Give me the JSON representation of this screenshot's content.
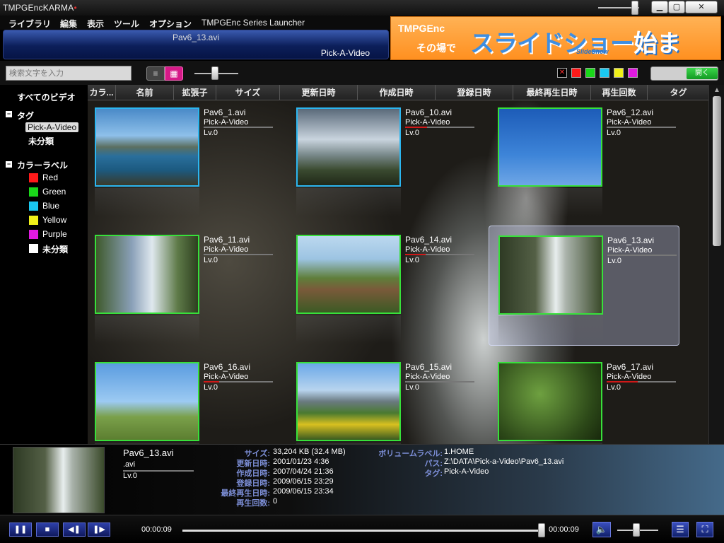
{
  "app": {
    "logo_main": "TMPGEnc",
    "logo_karma": "KARMA"
  },
  "window": {
    "min": "▁",
    "max": "▢",
    "close": "✕"
  },
  "menu": [
    {
      "label": "ライブラリ"
    },
    {
      "label": "編集"
    },
    {
      "label": "表示"
    },
    {
      "label": "ツール"
    },
    {
      "label": "オプション"
    },
    {
      "label": "TMPGEnc Series Launcher"
    }
  ],
  "now_playing": {
    "file": "Pav6_13.avi",
    "tag": "Pick-A-Video"
  },
  "ad": {
    "brand": "TMPGEnc",
    "sub": "その場で",
    "title_a": "スライドショー",
    "title_b": "始まる。",
    "slideshow": "SlideShow"
  },
  "toolbar": {
    "search_placeholder": "検索文字を入力",
    "view_list_icon": "≡",
    "view_grid_icon": "▦",
    "open_label": "開く",
    "color_filters": [
      {
        "name": "none",
        "color": "#000000",
        "mark": "✕"
      },
      {
        "name": "red",
        "color": "#ff1a1a",
        "mark": ""
      },
      {
        "name": "green",
        "color": "#1ad81a",
        "mark": ""
      },
      {
        "name": "blue",
        "color": "#1ac8f0",
        "mark": ""
      },
      {
        "name": "yellow",
        "color": "#f0f01a",
        "mark": ""
      },
      {
        "name": "purple",
        "color": "#e01ae0",
        "mark": ""
      }
    ]
  },
  "sidebar": {
    "all_videos": "すべてのビデオ",
    "tag_header": "タグ",
    "tags": [
      {
        "label": "Pick-A-Video"
      },
      {
        "label": "未分類"
      }
    ],
    "color_header": "カラーラベル",
    "colors": [
      {
        "label": "Red",
        "color": "#ff1a1a"
      },
      {
        "label": "Green",
        "color": "#1ad81a"
      },
      {
        "label": "Blue",
        "color": "#1ac8f0"
      },
      {
        "label": "Yellow",
        "color": "#f0f01a"
      },
      {
        "label": "Purple",
        "color": "#e01ae0"
      },
      {
        "label": "未分類",
        "color": "#ffffff"
      }
    ],
    "expander": "−"
  },
  "columns": [
    {
      "label": "カラ..."
    },
    {
      "label": "名前"
    },
    {
      "label": "拡張子"
    },
    {
      "label": "サイズ"
    },
    {
      "label": "更新日時"
    },
    {
      "label": "作成日時"
    },
    {
      "label": "登録日時"
    },
    {
      "label": "最終再生日時"
    },
    {
      "label": "再生回数"
    },
    {
      "label": "タグ"
    }
  ],
  "videos": [
    {
      "name": "Pav6_1.avi",
      "tag": "Pick-A-Video",
      "level": "Lv.0",
      "label_color": "cyan",
      "thumb": "lake",
      "progress": 0.0
    },
    {
      "name": "Pav6_10.avi",
      "tag": "Pick-A-Video",
      "level": "Lv.0",
      "label_color": "cyan",
      "thumb": "sky",
      "progress": 0.32
    },
    {
      "name": "Pav6_12.avi",
      "tag": "Pick-A-Video",
      "level": "Lv.0",
      "label_color": "green",
      "thumb": "blue",
      "progress": 0.0
    },
    {
      "name": "Pav6_11.avi",
      "tag": "Pick-A-Video",
      "level": "Lv.0",
      "label_color": "green",
      "thumb": "river",
      "progress": 0.0
    },
    {
      "name": "Pav6_14.avi",
      "tag": "Pick-A-Video",
      "level": "Lv.0",
      "label_color": "green",
      "thumb": "house",
      "progress": 0.3
    },
    {
      "name": "Pav6_13.avi",
      "tag": "Pick-A-Video",
      "level": "Lv.0",
      "label_color": "green",
      "thumb": "fall",
      "progress": 0.0,
      "selected": true
    },
    {
      "name": "Pav6_16.avi",
      "tag": "Pick-A-Video",
      "level": "Lv.0",
      "label_color": "green",
      "thumb": "tree",
      "progress": 0.22
    },
    {
      "name": "Pav6_15.avi",
      "tag": "Pick-A-Video",
      "level": "Lv.0",
      "label_color": "green",
      "thumb": "mtn",
      "progress": 0.0
    },
    {
      "name": "Pav6_17.avi",
      "tag": "Pick-A-Video",
      "level": "Lv.0",
      "label_color": "green",
      "thumb": "jungle",
      "progress": 0.45
    }
  ],
  "info": {
    "name": "Pav6_13.avi",
    "ext": ".avi",
    "level": "Lv.0",
    "size_label": "サイズ:",
    "size": "33,204 KB (32.4 MB)",
    "modified_label": "更新日時:",
    "modified": "2001/01/23 4:36",
    "created_label": "作成日時:",
    "created": "2007/04/24 21:36",
    "registered_label": "登録日時:",
    "registered": "2009/06/15 23:29",
    "last_played_label": "最終再生日時:",
    "last_played": "2009/06/15 23:34",
    "play_count_label": "再生回数:",
    "play_count": "0",
    "volume_label_label": "ボリュームラベル:",
    "volume_label": "1.HOME",
    "path_label": "パス:",
    "path": "Z:\\DATA\\Pick-a-Video\\Pav6_13.avi",
    "tag_label": "タグ:",
    "tag": "Pick-A-Video"
  },
  "player": {
    "pause": "❚❚",
    "stop": "■",
    "prev": "◀❚",
    "next": "❚▶",
    "time_current": "00:00:09",
    "time_total": "00:00:09",
    "volume_icon": "🔈",
    "list_icon": "☰",
    "fullscreen_icon": "⛶"
  }
}
